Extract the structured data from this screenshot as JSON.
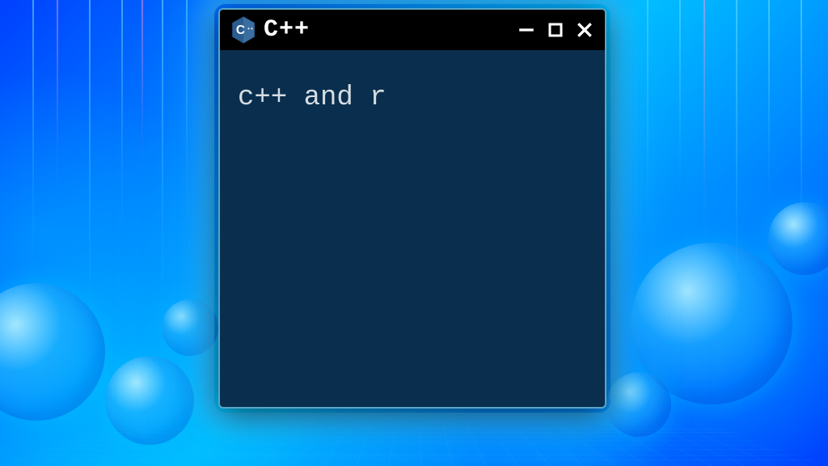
{
  "window": {
    "title": "C++",
    "logo_name": "cpp-logo-icon"
  },
  "terminal": {
    "content": "c++ and r"
  },
  "colors": {
    "terminal_bg": "#0a2e4d",
    "titlebar_bg": "#000000",
    "glow": "#40c8ff"
  }
}
